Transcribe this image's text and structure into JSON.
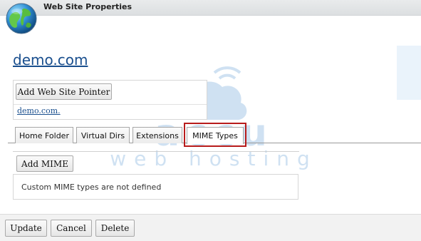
{
  "window": {
    "title": "Web Site Properties"
  },
  "site": {
    "name": "demo.com"
  },
  "pointers": {
    "add_button_label": "Add Web Site Pointer",
    "items": [
      "demo.com."
    ]
  },
  "tabs": [
    {
      "label": "Home Folder",
      "active": false
    },
    {
      "label": "Virtual Dirs",
      "active": false
    },
    {
      "label": "Extensions",
      "active": false
    },
    {
      "label": "MIME Types",
      "active": true
    }
  ],
  "mime": {
    "add_button_label": "Add MIME",
    "empty_message": "Custom MIME types are not defined"
  },
  "footer": {
    "update_label": "Update",
    "cancel_label": "Cancel",
    "delete_label": "Delete"
  },
  "watermark": {
    "line1": "accu",
    "line2": "web hosting"
  },
  "colors": {
    "link": "#1a4f8e",
    "highlight": "#b81c1c",
    "watermark": "#2a7cc7"
  },
  "icons": {
    "app": "globe-icon",
    "watermark": "cloud-icon"
  }
}
